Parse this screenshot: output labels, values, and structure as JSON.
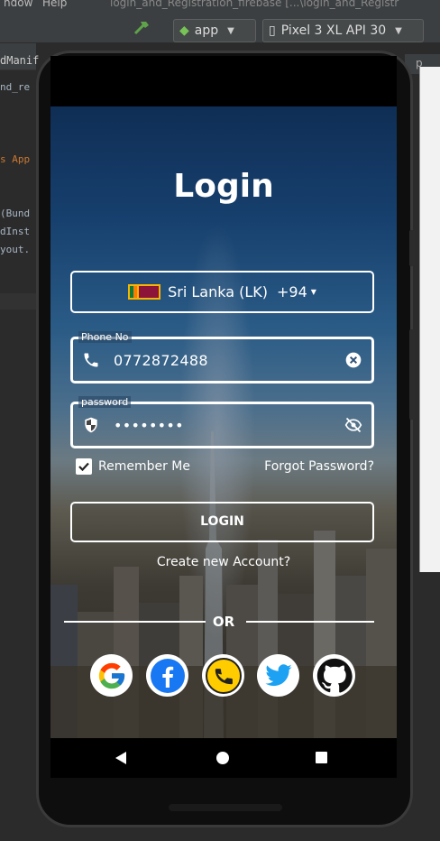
{
  "ide": {
    "menu_window": "ndow",
    "menu_help": "Help",
    "title": "login_and_Registration_firebase [...\\login_and_Registr",
    "run_config": "app",
    "device": "Pixel 3 XL API 30",
    "code_lines": [
      "dManif",
      "nd_re",
      "",
      "",
      "s App",
      "",
      "",
      "(Bund",
      "dInst",
      "yout."
    ]
  },
  "app": {
    "title": "Login",
    "country": {
      "name": "Sri Lanka (LK)",
      "dial_code": "+94"
    },
    "phone": {
      "label": "Phone No",
      "value": "0772872488"
    },
    "password": {
      "label": "password",
      "value": "••••••••"
    },
    "remember_me": {
      "label": "Remember Me",
      "checked": true
    },
    "forgot_password": "Forgot Password?",
    "login_button": "LOGIN",
    "create_account": "Create new Account?",
    "or_label": "OR",
    "social": [
      {
        "icon": "google-icon"
      },
      {
        "icon": "facebook-icon"
      },
      {
        "icon": "phone-icon"
      },
      {
        "icon": "twitter-icon"
      },
      {
        "icon": "github-icon"
      }
    ]
  },
  "colors": {
    "google_blue": "#4285F4",
    "facebook_blue": "#1877F2",
    "phone_yellow": "#FFCC00",
    "twitter_blue": "#1DA1F2"
  }
}
